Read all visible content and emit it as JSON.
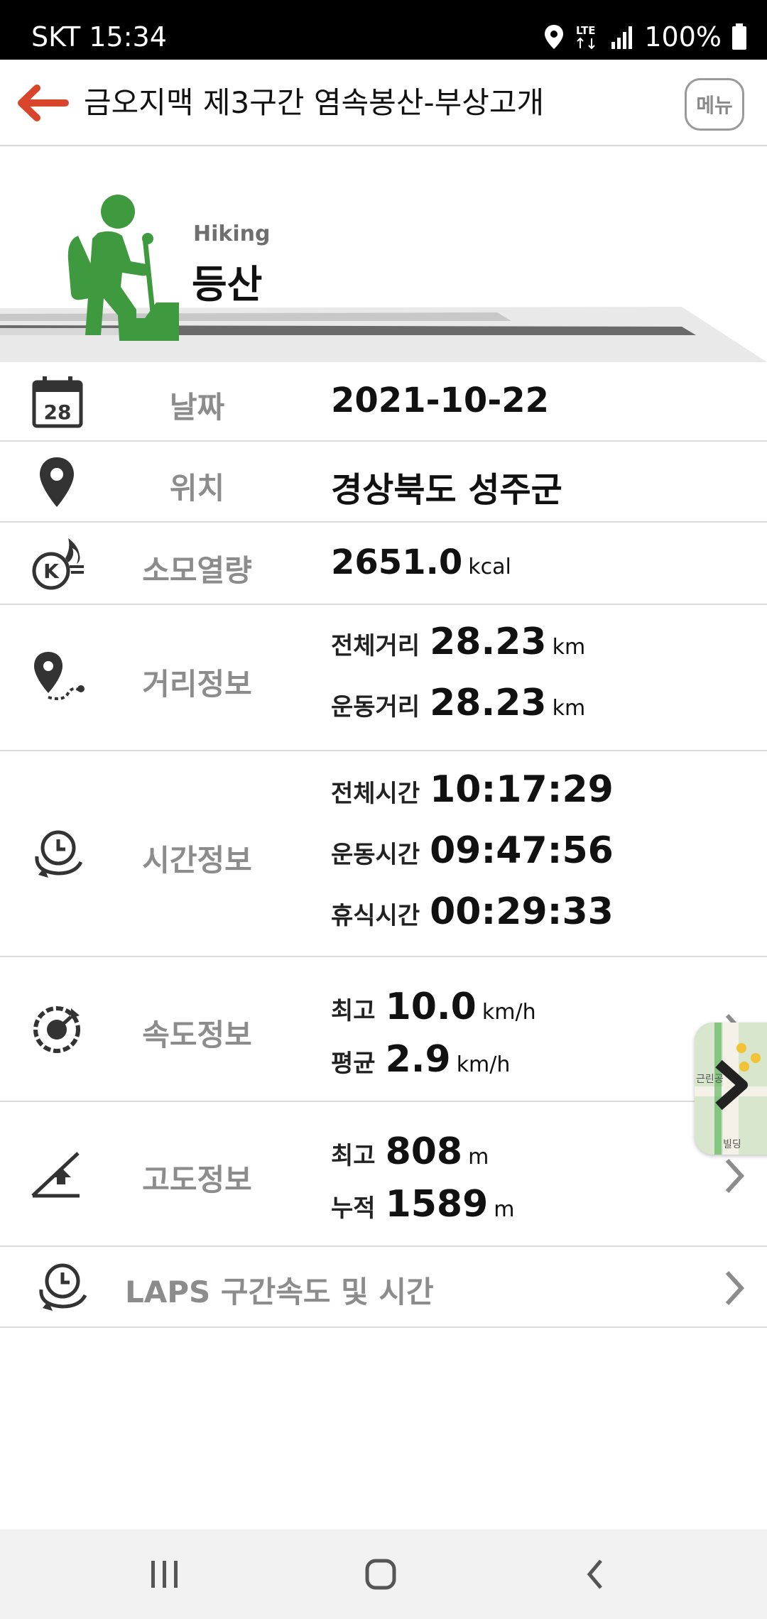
{
  "status_bar": {
    "carrier_time": "SKT 15:34",
    "network": "LTE",
    "battery": "100%",
    "icons": [
      "location-icon",
      "lte-icon",
      "signal-icon",
      "battery-icon"
    ]
  },
  "header": {
    "title": "금오지맥 제3구간 염속봉산-부상고개",
    "menu_label": "메뉴",
    "back_icon": "back-arrow-icon"
  },
  "activity": {
    "name_en": "Hiking",
    "name_ko": "등산",
    "icon": "hiker-icon",
    "color": "#3f9a3f"
  },
  "rows": {
    "date": {
      "icon": "calendar-icon",
      "icon_text": "28",
      "label": "날짜",
      "value": "2021-10-22"
    },
    "location": {
      "icon": "location-pin-icon",
      "label": "위치",
      "value": "경상북도 성주군"
    },
    "calories": {
      "icon": "kcal-flame-icon",
      "label": "소모열량",
      "value": "2651.0",
      "unit": "kcal"
    },
    "distance": {
      "icon": "route-pin-icon",
      "label": "거리정보",
      "total_label": "전체거리",
      "total_value": "28.23",
      "total_unit": "km",
      "moving_label": "운동거리",
      "moving_value": "28.23",
      "moving_unit": "km"
    },
    "time": {
      "icon": "clock-cycle-icon",
      "label": "시간정보",
      "total_label": "전체시간",
      "total_value": "10:17:29",
      "moving_label": "운동시간",
      "moving_value": "09:47:56",
      "rest_label": "휴식시간",
      "rest_value": "00:29:33"
    },
    "speed": {
      "icon": "speedometer-icon",
      "label": "속도정보",
      "max_label": "최고",
      "max_value": "10.0",
      "max_unit": "km/h",
      "avg_label": "평균",
      "avg_value": "2.9",
      "avg_unit": "km/h"
    },
    "altitude": {
      "icon": "altitude-icon",
      "label": "고도정보",
      "max_label": "최고",
      "max_value": "808",
      "max_unit": "m",
      "cum_label": "누적",
      "cum_value": "1589",
      "cum_unit": "m"
    },
    "laps": {
      "icon": "laps-clock-icon",
      "label": "LAPS 구간속도 및 시간"
    }
  },
  "map_thumb": {
    "label": "근린공",
    "label2": "빌딩"
  },
  "colors": {
    "accent_back": "#d9452b",
    "hiker_green": "#3f9a3f",
    "label_gray": "#8c8c8c"
  }
}
